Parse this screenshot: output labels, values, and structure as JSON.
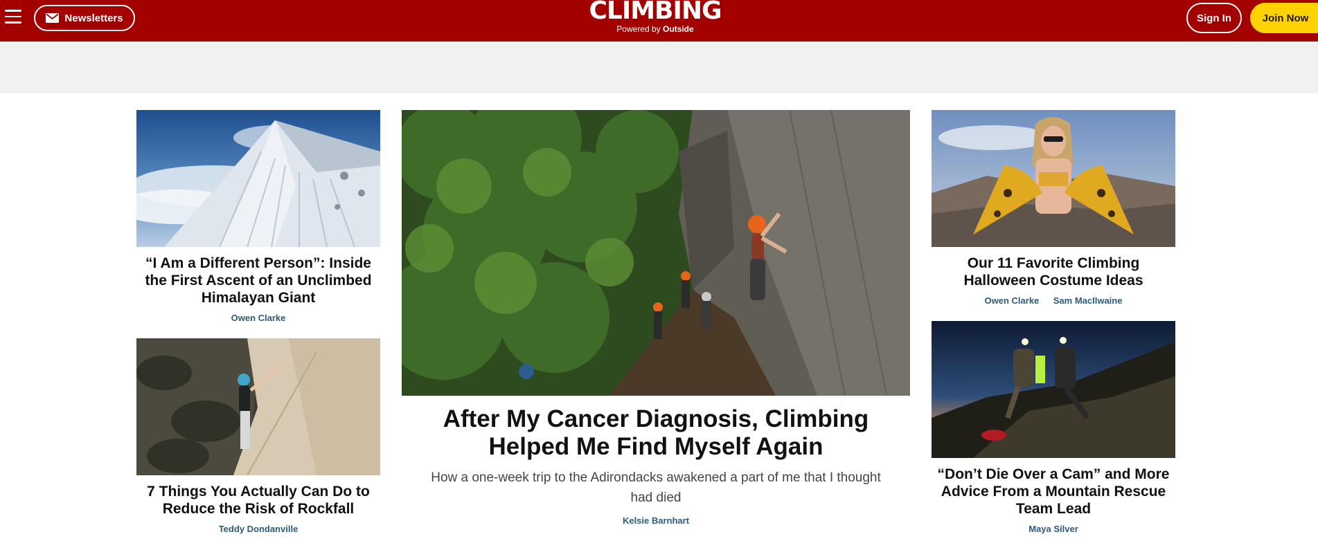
{
  "header": {
    "menu_icon": "hamburger-menu-icon",
    "newsletters_label": "Newsletters",
    "newsletters_icon": "envelope-icon",
    "logo_text": "CLIMBING",
    "tagline_prefix": "Powered by",
    "tagline_brand": "Outside",
    "signin_label": "Sign In",
    "join_label": "Join Now",
    "colors": {
      "header_bg": "#a30000",
      "join_bg": "#ffd200",
      "author_color": "#2e5a7a"
    }
  },
  "articles": {
    "left_top": {
      "title": "“I Am a Different Person”: Inside the First Ascent of an Unclimbed Himalayan Giant",
      "authors": [
        "Owen Clarke"
      ]
    },
    "left_bottom": {
      "title": "7 Things You Actually Can Do to Reduce the Risk of Rockfall",
      "authors": [
        "Teddy Dondanville"
      ]
    },
    "feature": {
      "title": "After My Cancer Diagnosis, Climbing Helped Me Find Myself Again",
      "dek": "How a one-week trip to the Adirondacks awakened a part of me that I thought had died",
      "authors": [
        "Kelsie Barnhart"
      ]
    },
    "right_top": {
      "title": "Our 11 Favorite Climbing Halloween Costume Ideas",
      "authors": [
        "Owen Clarke",
        "Sam MacIlwaine"
      ]
    },
    "right_bottom": {
      "title": "“Don’t Die Over a Cam” and More Advice From a Mountain Rescue Team Lead",
      "authors": [
        "Maya Silver"
      ]
    }
  }
}
